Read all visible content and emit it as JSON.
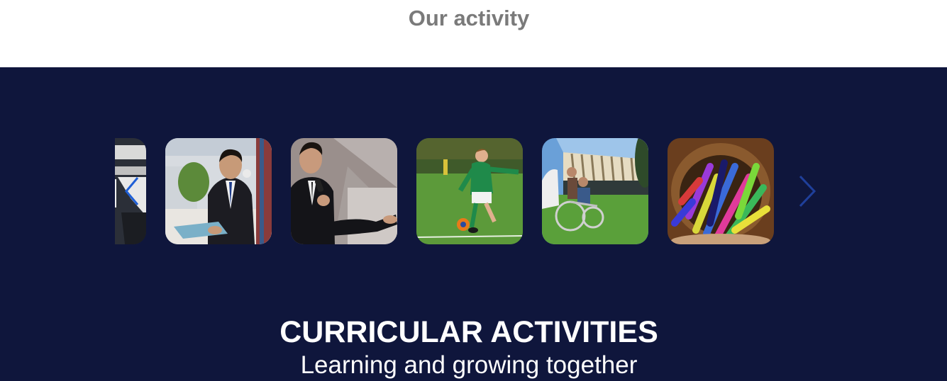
{
  "section": {
    "title": "Our activity"
  },
  "carousel": {
    "prev_icon": "chevron-left-icon",
    "next_icon": "chevron-right-icon",
    "slides": [
      {
        "id": "partial-slide",
        "photo": "partially visible slide"
      },
      {
        "id": "student-reading",
        "photo": "student in suit reading a book"
      },
      {
        "id": "student-speaking",
        "photo": "student speaking into a microphone"
      },
      {
        "id": "boy-football",
        "photo": "boy kicking a football on grass"
      },
      {
        "id": "wheelchair-lawn",
        "photo": "person in a wheelchair on a lawn"
      },
      {
        "id": "crayons-pot",
        "photo": "pot of colorful crayons"
      }
    ]
  },
  "banner": {
    "heading": "CURRICULAR ACTIVITIES",
    "subheading": "Learning and growing together"
  },
  "colors": {
    "band_background": "#0f163c",
    "title_gray": "#7a7a7a",
    "arrow_blue": "#1f5fd6"
  }
}
